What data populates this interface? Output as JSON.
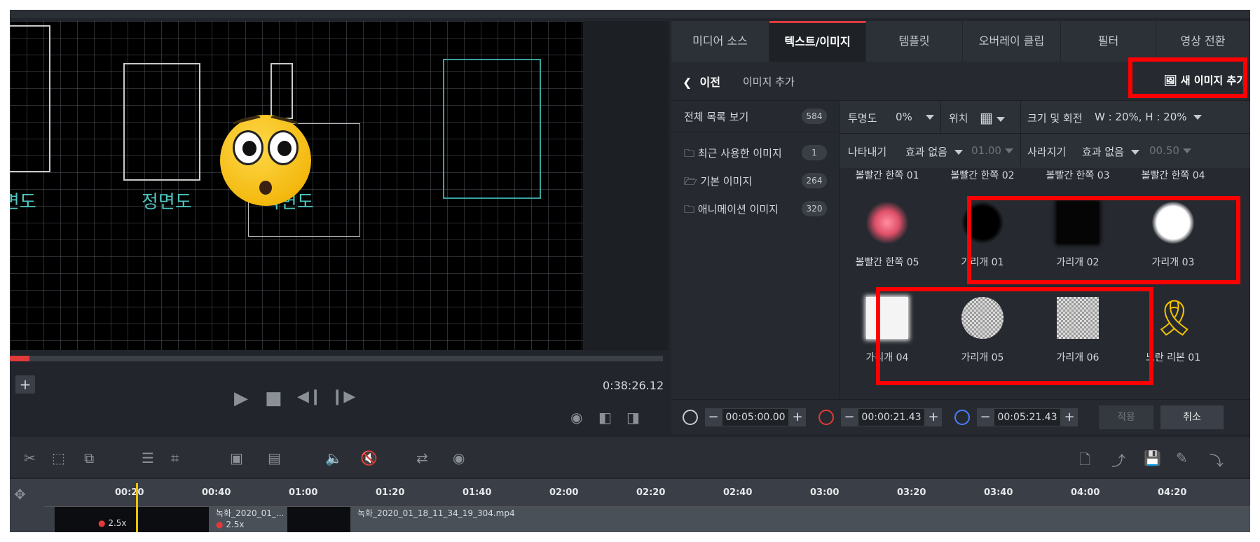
{
  "preview": {
    "labels": [
      "면도",
      "정면도",
      "측면도"
    ],
    "timecode": "0:38:26.12",
    "progress": 0.03
  },
  "tabs": [
    "미디어 소스",
    "텍스트/이미지",
    "템플릿",
    "오버레이 클립",
    "필터",
    "영상 전환"
  ],
  "active_tab": "텍스트/이미지",
  "subheader": {
    "back_label": "이전",
    "breadcrumb": "이미지 추가",
    "new_image_label": "새 이미지 추가"
  },
  "categories": [
    {
      "label": "전체 목록 보기",
      "count": "584",
      "icon": "list-icon"
    },
    {
      "label": "최근 사용한 이미지",
      "count": "1",
      "icon": "recent-folder-icon"
    },
    {
      "label": "기본 이미지",
      "count": "264",
      "icon": "open-folder-icon"
    },
    {
      "label": "애니메이션 이미지",
      "count": "320",
      "icon": "folder-icon"
    }
  ],
  "props": {
    "opacity_label": "투명도",
    "opacity_value": "0%",
    "position_label": "위치",
    "size_label": "크기 및 회전",
    "size_value": "W : 20%, H : 20%",
    "appear_label": "나타내기",
    "appear_value": "효과 없음",
    "appear_time": "01.00",
    "disappear_label": "사라지기",
    "disappear_value": "효과 없음",
    "disappear_time": "00.50"
  },
  "items_row0": [
    "볼빨간 한쪽 01",
    "볼빨간 한쪽 02",
    "볼빨간 한쪽 03",
    "볼빨간 한쪽 04"
  ],
  "items_row1": [
    "볼빨간 한쪽 05",
    "가리개 01",
    "가리개 02",
    "가리개 03"
  ],
  "items_row2": [
    "가리개 04",
    "가리개 05",
    "가리개 06",
    "노란 리본 01"
  ],
  "bottom": {
    "time1": "00:05:00.00",
    "time2": "00:00:21.43",
    "time3": "00:05:21.43",
    "apply_label": "적용",
    "cancel_label": "취소"
  },
  "ruler_ticks": [
    "00:20",
    "00:40",
    "01:00",
    "01:20",
    "01:40",
    "02:00",
    "02:20",
    "02:40",
    "03:00",
    "03:20",
    "03:40",
    "04:00",
    "04:20"
  ],
  "clips": {
    "clip1_name": "녹화_2020_01_...",
    "clip2_name": "녹화_2020_01_18_11_34_19_304.mp4",
    "speed1": "2.5x",
    "speed2": "2.5x"
  },
  "colors": {
    "accent": "#e23a3a",
    "highlight": "#ff0000",
    "playhead": "#f2c200",
    "cad_text": "#4ec6c0"
  }
}
